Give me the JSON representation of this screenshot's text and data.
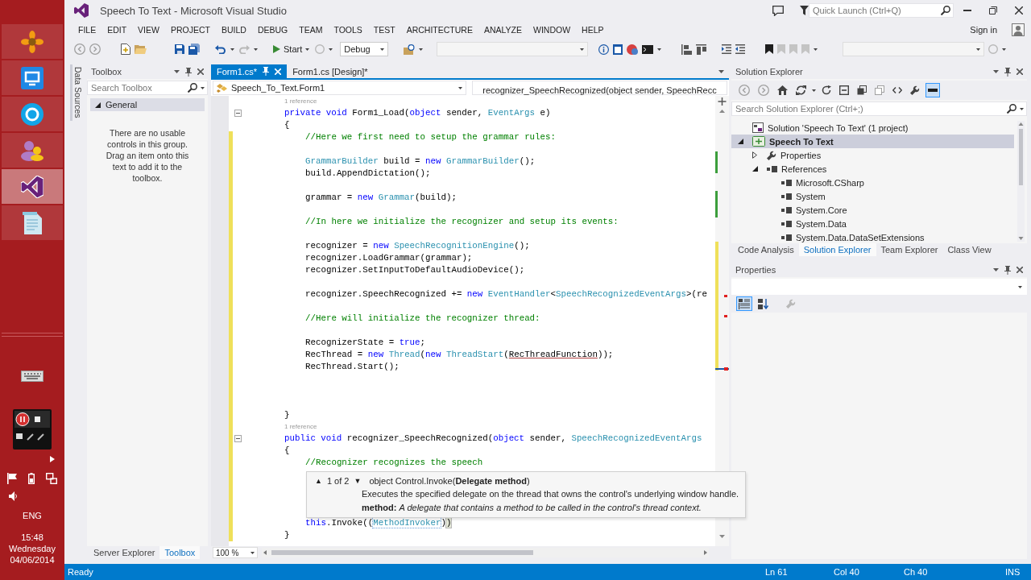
{
  "window": {
    "title": "Speech To Text - Microsoft Visual Studio",
    "quick_launch": {
      "placeholder": "Quick Launch (Ctrl+Q)"
    }
  },
  "taskbar": {
    "apps": [
      {
        "selected": false
      },
      {
        "selected": false
      },
      {
        "selected": false
      },
      {
        "selected": false
      },
      {
        "selected": true
      },
      {
        "selected": false
      }
    ],
    "language": "ENG",
    "time": "15:48",
    "day": "Wednesday",
    "date": "04/06/2014"
  },
  "menu": {
    "items": [
      "FILE",
      "EDIT",
      "VIEW",
      "PROJECT",
      "BUILD",
      "DEBUG",
      "TEAM",
      "TOOLS",
      "TEST",
      "ARCHITECTURE",
      "ANALYZE",
      "WINDOW",
      "HELP"
    ],
    "sign_in": "Sign in"
  },
  "toolbar": {
    "start": "Start",
    "configuration": "Debug"
  },
  "side_tabs": [
    "Data Sources"
  ],
  "toolbox": {
    "title": "Toolbox",
    "search": {
      "placeholder": "Search Toolbox"
    },
    "groups": [
      {
        "label": "General",
        "expanded": true
      }
    ],
    "empty_message": "There are no usable controls in this group. Drag an item onto this text to add it to the toolbox.",
    "tabs": [
      {
        "label": "Server Explorer",
        "selected": false
      },
      {
        "label": "Toolbox",
        "selected": true
      }
    ]
  },
  "editor": {
    "tabs": [
      {
        "label": "Form1.cs*",
        "selected": true
      },
      {
        "label": "Form1.cs [Design]*",
        "selected": false
      }
    ],
    "class_dropdown": "Speech_To_Text.Form1",
    "member_dropdown": "recognizer_SpeechRecognized(object sender, SpeechRecc",
    "lines": [
      {
        "kind": "codelens",
        "text": "1 reference",
        "changed": false
      },
      {
        "kind": "code",
        "changed": false,
        "expanded": true,
        "tokens": [
          {
            "kind": "keyword",
            "text": "private "
          },
          {
            "kind": "keyword",
            "text": "void"
          },
          {
            "kind": "text",
            "text": " Form1_Load("
          },
          {
            "kind": "keyword",
            "text": "object"
          },
          {
            "kind": "text",
            "text": " sender, "
          },
          {
            "kind": "type",
            "text": "EventArgs"
          },
          {
            "kind": "text",
            "text": " e)"
          }
        ]
      },
      {
        "kind": "code",
        "changed": false,
        "tokens": [
          {
            "kind": "text",
            "text": "{"
          }
        ],
        "children": [
          {
            "kind": "code",
            "changed": true,
            "tokens": [
              {
                "kind": "comment",
                "text": "//Here we first need to setup the grammar rules:"
              }
            ]
          },
          {
            "kind": "blank",
            "changed": true
          },
          {
            "kind": "code",
            "changed": true,
            "tokens": [
              {
                "kind": "type",
                "text": "GrammarBuilder"
              },
              {
                "kind": "text",
                "text": " build = "
              },
              {
                "kind": "keyword",
                "text": "new "
              },
              {
                "kind": "type",
                "text": "GrammarBuilder"
              },
              {
                "kind": "text",
                "text": "();"
              }
            ]
          },
          {
            "kind": "code",
            "changed": true,
            "tokens": [
              {
                "kind": "text",
                "text": "build.AppendDictation();"
              }
            ]
          },
          {
            "kind": "blank",
            "changed": true
          },
          {
            "kind": "code",
            "changed": true,
            "tokens": [
              {
                "kind": "text",
                "text": "grammar = "
              },
              {
                "kind": "keyword",
                "text": "new "
              },
              {
                "kind": "type",
                "text": "Grammar"
              },
              {
                "kind": "text",
                "text": "(build);"
              }
            ]
          },
          {
            "kind": "blank",
            "changed": true
          },
          {
            "kind": "code",
            "changed": true,
            "tokens": [
              {
                "kind": "comment",
                "text": "//In here we initialize the recognizer and setup its events:"
              }
            ]
          },
          {
            "kind": "blank",
            "changed": true
          },
          {
            "kind": "code",
            "changed": true,
            "tokens": [
              {
                "kind": "text",
                "text": "recognizer = "
              },
              {
                "kind": "keyword",
                "text": "new "
              },
              {
                "kind": "type",
                "text": "SpeechRecognitionEngine"
              },
              {
                "kind": "text",
                "text": "();"
              }
            ]
          },
          {
            "kind": "code",
            "changed": true,
            "tokens": [
              {
                "kind": "text",
                "text": "recognizer.LoadGrammar(grammar);"
              }
            ]
          },
          {
            "kind": "code",
            "changed": true,
            "tokens": [
              {
                "kind": "text",
                "text": "recognizer.SetInputToDefaultAudioDevice();"
              }
            ]
          },
          {
            "kind": "blank",
            "changed": true
          },
          {
            "kind": "code",
            "changed": true,
            "tokens": [
              {
                "kind": "text",
                "text": "recognizer.SpeechRecognized += "
              },
              {
                "kind": "keyword",
                "text": "new "
              },
              {
                "kind": "type",
                "text": "EventHandler"
              },
              {
                "kind": "text",
                "text": "<"
              },
              {
                "kind": "type",
                "text": "SpeechRecognizedEventArgs"
              },
              {
                "kind": "text",
                "text": ">(re"
              }
            ]
          },
          {
            "kind": "blank",
            "changed": true
          },
          {
            "kind": "code",
            "changed": true,
            "tokens": [
              {
                "kind": "comment",
                "text": "//Here will initialize the recognizer thread:"
              }
            ]
          },
          {
            "kind": "blank",
            "changed": true
          },
          {
            "kind": "code",
            "changed": true,
            "tokens": [
              {
                "kind": "text",
                "text": "RecognizerState = "
              },
              {
                "kind": "keyword",
                "text": "true"
              },
              {
                "kind": "text",
                "text": ";"
              }
            ]
          },
          {
            "kind": "code",
            "changed": true,
            "tokens": [
              {
                "kind": "text",
                "text": "RecThread = "
              },
              {
                "kind": "keyword",
                "text": "new "
              },
              {
                "kind": "type",
                "text": "Thread"
              },
              {
                "kind": "text",
                "text": "("
              },
              {
                "kind": "keyword",
                "text": "new "
              },
              {
                "kind": "type",
                "text": "ThreadStart"
              },
              {
                "kind": "text",
                "text": "("
              },
              {
                "kind": "error",
                "text": "RecThreadFunction"
              },
              {
                "kind": "text",
                "text": "));"
              }
            ]
          },
          {
            "kind": "code",
            "changed": true,
            "tokens": [
              {
                "kind": "text",
                "text": "RecThread.Start();"
              }
            ]
          },
          {
            "kind": "blank",
            "changed": true
          },
          {
            "kind": "blank",
            "changed": true
          },
          {
            "kind": "blank",
            "changed": true
          }
        ]
      },
      {
        "kind": "code",
        "changed": true,
        "tokens": [
          {
            "kind": "text",
            "text": "}"
          }
        ]
      },
      {
        "kind": "codelens",
        "text": "1 reference",
        "changed": true
      },
      {
        "kind": "code",
        "changed": true,
        "expanded": true,
        "tokens": [
          {
            "kind": "keyword",
            "text": "public "
          },
          {
            "kind": "keyword",
            "text": "void"
          },
          {
            "kind": "text",
            "text": " recognizer_SpeechRecognized("
          },
          {
            "kind": "keyword",
            "text": "object"
          },
          {
            "kind": "text",
            "text": " sender, "
          },
          {
            "kind": "type",
            "text": "SpeechRecognizedEventArgs"
          }
        ]
      },
      {
        "kind": "code",
        "changed": true,
        "tokens": [
          {
            "kind": "text",
            "text": "{"
          }
        ],
        "children": [
          {
            "kind": "code",
            "changed": true,
            "tokens": [
              {
                "kind": "comment",
                "text": "//Recognizer recognizes the speech"
              }
            ]
          },
          {
            "kind": "blank",
            "changed": true
          },
          {
            "kind": "blank",
            "changed": true
          },
          {
            "kind": "blank",
            "changed": true
          },
          {
            "kind": "blank",
            "changed": true
          },
          {
            "kind": "code",
            "changed": true,
            "tokens": [
              {
                "kind": "keyword",
                "text": "this"
              },
              {
                "kind": "text",
                "text": ".Invoke(("
              },
              {
                "kind": "reference",
                "text": "MethodInvoker"
              },
              {
                "kind": "text",
                "text": ")"
              },
              {
                "kind": "brace",
                "text": ")"
              }
            ]
          }
        ]
      },
      {
        "kind": "code",
        "changed": true,
        "tokens": [
          {
            "kind": "text",
            "text": "}"
          }
        ]
      }
    ],
    "tooltip": {
      "previous": "▲",
      "counter": "1 of 2",
      "next": "▼",
      "signature": "object Control.Invoke(**Delegate method**)",
      "summary": "Executes the specified delegate on the thread that owns the control's underlying window handle.",
      "parameter": "**method:** *A delegate that contains a method to be called in the control's thread context.*"
    },
    "zoom": "100 %"
  },
  "solution_explorer": {
    "title": "Solution Explorer",
    "toolbar": [
      {
        "selected": false
      },
      {
        "selected": false
      },
      {
        "selected": false
      },
      {
        "selected": false
      },
      {
        "selected": false
      },
      {
        "selected": false
      },
      {
        "selected": false
      },
      {
        "selected": false
      },
      {
        "selected": false
      },
      {
        "selected": false
      },
      {
        "selected": true
      }
    ],
    "search": {
      "placeholder": "Search Solution Explorer (Ctrl+;)"
    },
    "tree": [
      {
        "label": "Solution 'Speech To Text' (1 project)",
        "kind": "solution",
        "selected": false,
        "children": [
          {
            "label": "Speech To Text",
            "kind": "project",
            "selected": true,
            "expanded": true,
            "children": [
              {
                "label": "Properties",
                "kind": "properties",
                "selected": false,
                "expanded": false
              },
              {
                "label": "References",
                "kind": "references",
                "selected": false,
                "expanded": true,
                "children": [
                  {
                    "label": "Microsoft.CSharp",
                    "kind": "reference",
                    "selected": false
                  },
                  {
                    "label": "System",
                    "kind": "reference",
                    "selected": false
                  },
                  {
                    "label": "System.Core",
                    "kind": "reference",
                    "selected": false
                  },
                  {
                    "label": "System.Data",
                    "kind": "reference",
                    "selected": false
                  },
                  {
                    "label": "System.Data.DataSetExtensions",
                    "kind": "reference",
                    "selected": false
                  }
                ]
              }
            ]
          }
        ]
      }
    ],
    "tabs": [
      {
        "label": "Code Analysis",
        "selected": false
      },
      {
        "label": "Solution Explorer",
        "selected": true
      },
      {
        "label": "Team Explorer",
        "selected": false
      },
      {
        "label": "Class View",
        "selected": false
      }
    ]
  },
  "properties": {
    "title": "Properties",
    "view_buttons": [
      {
        "selected": true
      },
      {
        "selected": false
      }
    ]
  },
  "status_bar": {
    "message": "Ready",
    "line": "Ln 61",
    "column": "Col 40",
    "character": "Ch 40",
    "mode": "INS"
  }
}
